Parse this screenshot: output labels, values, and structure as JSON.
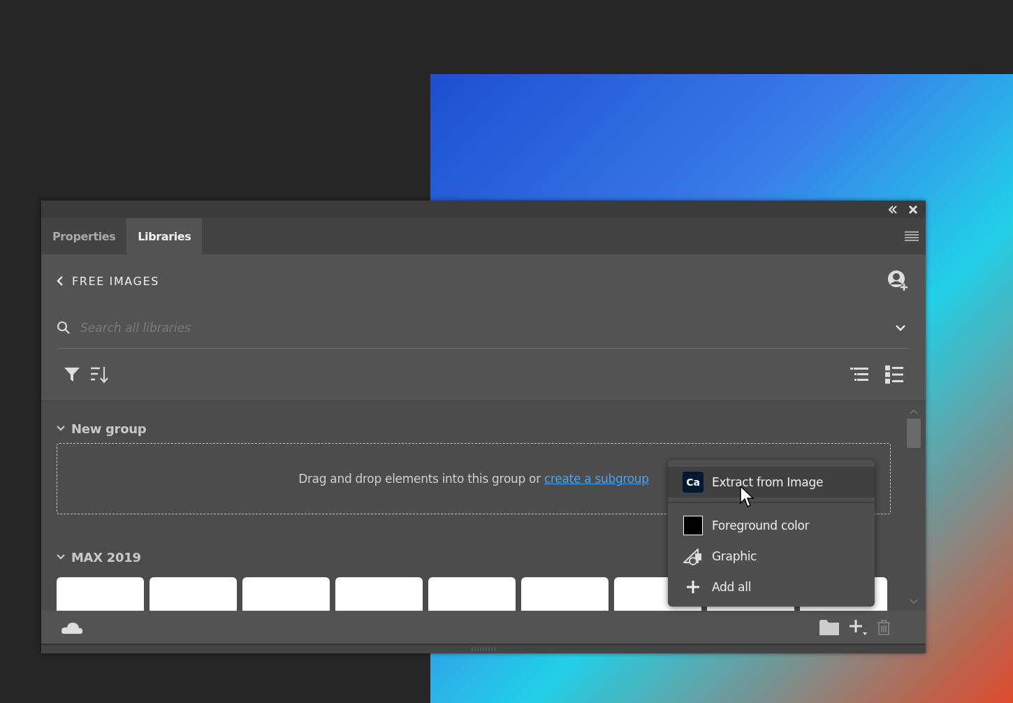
{
  "tabs": [
    {
      "label": "Properties",
      "selected": false
    },
    {
      "label": "Libraries",
      "selected": true
    }
  ],
  "header": {
    "title": "FREE IMAGES"
  },
  "search": {
    "placeholder": "Search all libraries"
  },
  "groups": [
    {
      "title": "New group",
      "expanded": true,
      "kind": "empty",
      "hint": "Drag and drop elements into this group or ",
      "link": "create a subgroup"
    },
    {
      "title": "MAX 2019",
      "expanded": true,
      "kind": "tiles"
    }
  ],
  "menu": {
    "items": [
      {
        "kind": "app",
        "badge": "Ca",
        "label": "Extract from Image",
        "highlighted": true
      },
      {
        "kind": "swatch",
        "color": "#000000",
        "label": "Foreground color",
        "highlighted": false
      },
      {
        "kind": "graphic",
        "label": "Graphic",
        "highlighted": false
      },
      {
        "kind": "add",
        "label": "Add all",
        "highlighted": false
      }
    ]
  }
}
